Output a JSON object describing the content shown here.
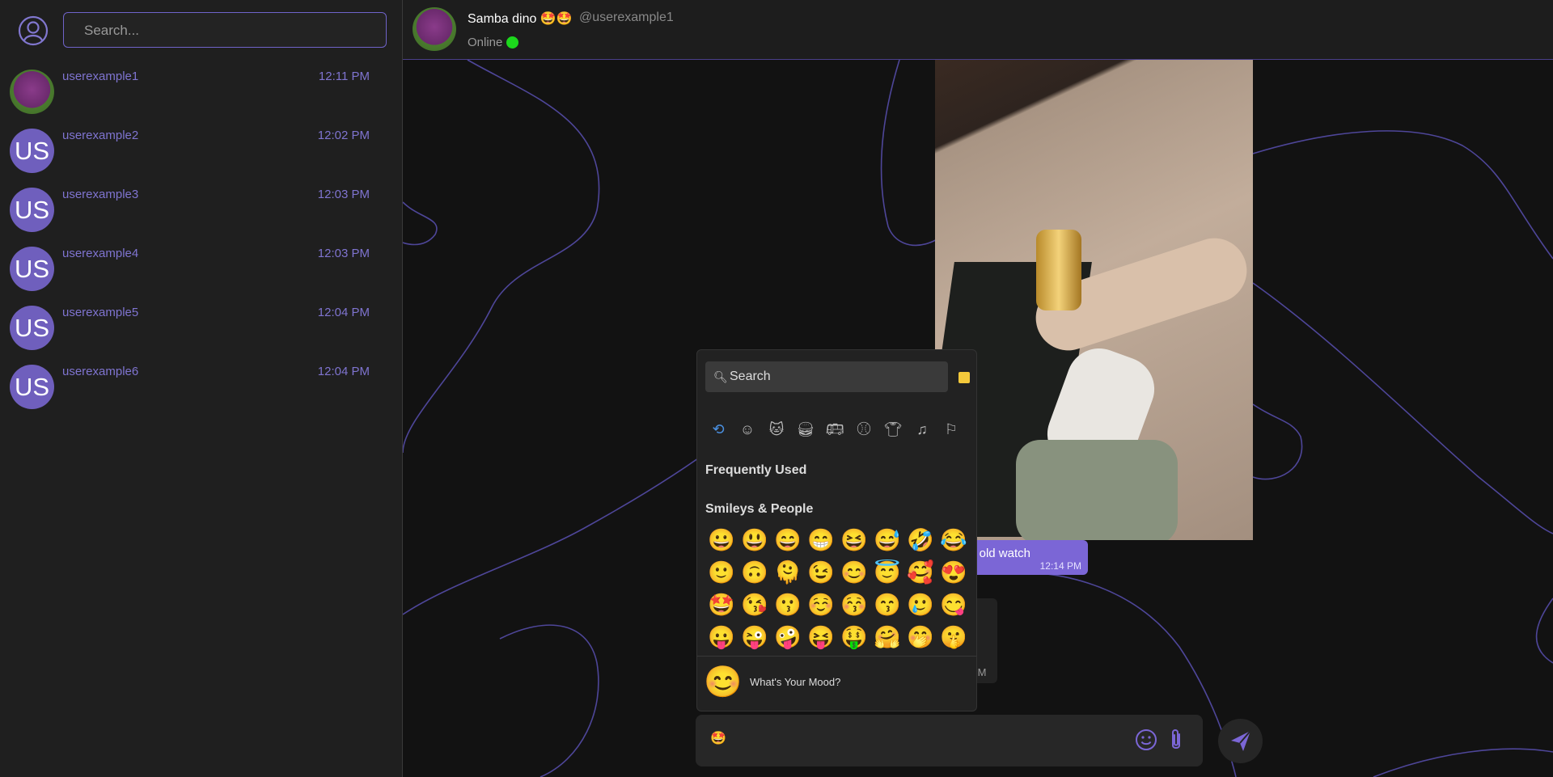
{
  "sidebar": {
    "search_placeholder": "Search...",
    "contacts": [
      {
        "name": "userexample1",
        "time": "12:11 PM",
        "avatar": "barney"
      },
      {
        "name": "userexample2",
        "time": "12:02 PM",
        "avatar": "US"
      },
      {
        "name": "userexample3",
        "time": "12:03 PM",
        "avatar": "US"
      },
      {
        "name": "userexample4",
        "time": "12:03 PM",
        "avatar": "US"
      },
      {
        "name": "userexample5",
        "time": "12:04 PM",
        "avatar": "US"
      },
      {
        "name": "userexample6",
        "time": "12:04 PM",
        "avatar": "US"
      }
    ]
  },
  "header": {
    "display_name": "Samba dino 🤩🤩",
    "handle": "@userexample1",
    "status": "Online"
  },
  "messages": {
    "caption_text": "old watch",
    "caption_time": "12:14 PM",
    "partial_time": "PM"
  },
  "emoji_picker": {
    "search_placeholder": "Search",
    "section_frequent": "Frequently Used",
    "section_smileys": "Smileys & People",
    "categories": [
      "recent-icon",
      "smileys-icon",
      "animals-icon",
      "food-icon",
      "travel-icon",
      "activity-icon",
      "objects-icon",
      "symbols-icon",
      "flags-icon"
    ],
    "emojis": [
      "😀",
      "😃",
      "😄",
      "😁",
      "😆",
      "😅",
      "🤣",
      "😂",
      "🙂",
      "🙃",
      "🫠",
      "😉",
      "😊",
      "😇",
      "🥰",
      "😍",
      "🤩",
      "😘",
      "😗",
      "☺️",
      "😚",
      "😙",
      "🥲",
      "😋",
      "😛",
      "😜",
      "🤪",
      "😝",
      "🤑",
      "🤗",
      "🤭",
      "🤫"
    ],
    "mood_face": "😊",
    "mood_label": "What's Your Mood?"
  },
  "composer": {
    "text": "🤩"
  },
  "colors": {
    "accent": "#7b66d6",
    "online": "#1cd81c",
    "skin_tone": "#f4c93b"
  }
}
